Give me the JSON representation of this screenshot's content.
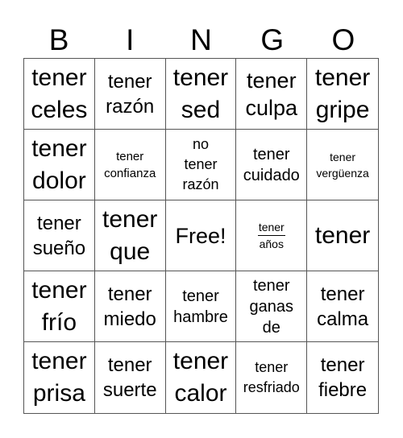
{
  "header": [
    "B",
    "I",
    "N",
    "G",
    "O"
  ],
  "cells": [
    "tener\nceles",
    "tener\nrazón",
    "tener\nsed",
    "tener\nculpa",
    "tener\ngripe",
    "tener\ndolor",
    "tener\nconfianza",
    "no\ntener\nrazón",
    "tener\ncuidado",
    "tener\nvergüenza",
    "tener\nsueño",
    "tener\nque",
    "Free!",
    "tener",
    "tener",
    "tener\nfrío",
    "tener\nmiedo",
    "tener\nhambre",
    "tener\nganas\nde",
    "tener\ncalma",
    "tener\nprisa",
    "tener\nsuerte",
    "tener\ncalor",
    "tener\nresfriado",
    "tener\nfiebre"
  ],
  "anos_cell": {
    "first": "tener",
    "second": "años"
  }
}
